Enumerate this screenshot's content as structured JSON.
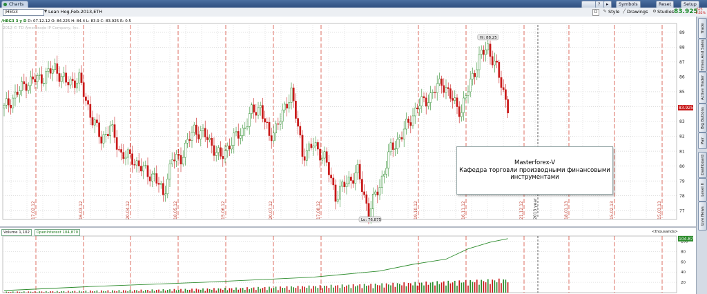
{
  "window": {
    "tab_label": "Charts"
  },
  "header_buttons": [
    "Symbols",
    "Reset",
    "Setup"
  ],
  "toolbar": {
    "symbol": "/HEG3",
    "description": "Lean Hog,Feb-2013,ETH",
    "period_button": "D",
    "style_label": "Style",
    "drawings_label": "Drawings",
    "studies_label": "Studies",
    "last_price": "83.925",
    "change_top": "-.525",
    "change_bottom": "-0.62%"
  },
  "infobar": {
    "name": "/HEG3 3 y D",
    "date": "D: 07.12.12",
    "open": "O: 84.225",
    "high": "H: 84.4",
    "low": "L: 83.9",
    "close": "C: 83.925",
    "range": "R: 0.5"
  },
  "copyright": "2012 © TD Ameritrade IP Company, Inc.",
  "annotations": {
    "hi_label": "Hi: 88.25",
    "lo_label": "Lo: 76.875",
    "price_tag": "83.925",
    "volume_tag": "104.87"
  },
  "note": {
    "line1": "Masterforex-V",
    "line2": "Кафедра торговли производными финансовыми",
    "line3": "инструментами"
  },
  "lower_panel": {
    "volume_label": "Volume",
    "volume_value": "1,102",
    "oi_label": "OpenInterest",
    "oi_value": "104,870",
    "units_label": "<thousands>"
  },
  "side_tabs": [
    "Trade",
    "Times And Sales",
    "Active Trader",
    "Big Buttons",
    "Pair",
    "Dashboard",
    "Level II",
    "Live News"
  ],
  "colors": {
    "up": "#2d8c2d",
    "down": "#c81818",
    "grid": "#c9c9c9",
    "divider": "#d44a3a",
    "oi_line": "#2d8c2d"
  },
  "chart_data": [
    {
      "type": "candlestick",
      "title": "/HEG3 3 y D",
      "ylim": [
        76.5,
        89.5
      ],
      "y_ticks": [
        77,
        78,
        79,
        80,
        81,
        82,
        83,
        84,
        85,
        86,
        87,
        88,
        89
      ],
      "x_ticks": [
        "17.02.12",
        "16.03.12",
        "20.04.12",
        "18.05.12",
        "15.06.12",
        "20.07.12",
        "17.08.12",
        "19.10.12",
        "16.11.12",
        "21.12.12",
        "2013 year",
        "18.01.13",
        "15.02.13",
        "15.03.13"
      ],
      "close_path": [
        [
          0,
          83.9
        ],
        [
          10,
          85.6
        ],
        [
          18,
          86.0
        ],
        [
          23,
          86.6
        ],
        [
          28,
          85.6
        ],
        [
          34,
          85.8
        ],
        [
          40,
          83.1
        ],
        [
          44,
          81.8
        ],
        [
          48,
          82.6
        ],
        [
          53,
          80.8
        ],
        [
          58,
          80.5
        ],
        [
          63,
          79.7
        ],
        [
          68,
          79.3
        ],
        [
          72,
          78.1
        ],
        [
          76,
          80.4
        ],
        [
          80,
          80.6
        ],
        [
          86,
          82.5
        ],
        [
          92,
          81.9
        ],
        [
          98,
          80.5
        ],
        [
          102,
          81.5
        ],
        [
          108,
          82.4
        ],
        [
          112,
          83.6
        ],
        [
          116,
          84.0
        ],
        [
          120,
          81.9
        ],
        [
          126,
          83.4
        ],
        [
          130,
          85.1
        ],
        [
          135,
          80.8
        ],
        [
          140,
          81.4
        ],
        [
          145,
          80.6
        ],
        [
          150,
          78.0
        ],
        [
          155,
          78.9
        ],
        [
          160,
          79.6
        ],
        [
          165,
          76.9
        ],
        [
          170,
          78.7
        ],
        [
          175,
          81.1
        ],
        [
          180,
          82.1
        ],
        [
          187,
          84.0
        ],
        [
          193,
          84.7
        ],
        [
          198,
          85.7
        ],
        [
          203,
          84.4
        ],
        [
          207,
          83.7
        ],
        [
          212,
          86.1
        ],
        [
          216,
          87.5
        ],
        [
          219,
          88.0
        ],
        [
          223,
          86.5
        ],
        [
          228,
          84.0
        ]
      ],
      "volume_bars": [
        2,
        3,
        4,
        6,
        9,
        12,
        15,
        18,
        20,
        14,
        10,
        6
      ],
      "open_interest_path": [
        [
          0,
          4
        ],
        [
          40,
          12
        ],
        [
          90,
          20
        ],
        [
          140,
          30
        ],
        [
          170,
          42
        ],
        [
          185,
          55
        ],
        [
          200,
          65
        ],
        [
          210,
          85
        ],
        [
          220,
          98
        ],
        [
          228,
          104.87
        ]
      ],
      "volume_ylim": [
        0,
        110
      ],
      "volume_ticks": [
        20,
        40,
        60,
        80,
        100
      ]
    }
  ]
}
